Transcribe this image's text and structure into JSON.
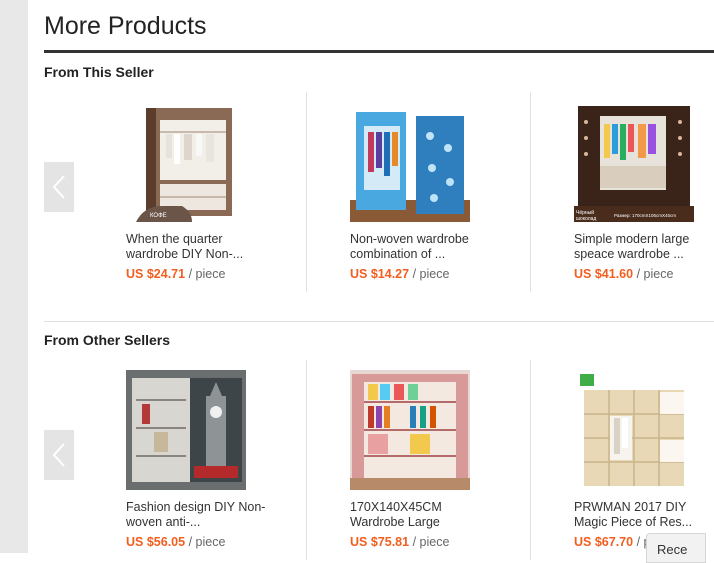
{
  "page": {
    "heading": "More Products"
  },
  "sections": [
    {
      "title": "From This Seller",
      "products": [
        {
          "title_line1": "When the quarter",
          "title_line2": "wardrobe DIY Non-...",
          "price": "US $24.71",
          "unit": "/ piece",
          "image_badge": "КОФЕ",
          "colors": [
            "#8a6a55",
            "#5a3d2b"
          ]
        },
        {
          "title_line1": "Non-woven wardrobe",
          "title_line2": "combination of ...",
          "price": "US $14.27",
          "unit": "/ piece",
          "colors": [
            "#4aa8e0",
            "#2f7fbf"
          ]
        },
        {
          "title_line1": "Simple modern large",
          "title_line2": "speace wardrobe ...",
          "price": "US $41.60",
          "unit": "/ piece",
          "image_caption_left": "Чёрный шоколад",
          "image_caption_right": "Размер: 170cmX105cmX45cm",
          "colors": [
            "#3a2318",
            "#1e120b"
          ]
        }
      ]
    },
    {
      "title": "From Other Sellers",
      "products": [
        {
          "title_line1": "Fashion design DIY Non-",
          "title_line2": "woven anti-...",
          "price": "US $56.05",
          "unit": "/ piece",
          "colors": [
            "#5d6a6e",
            "#3d4548"
          ]
        },
        {
          "title_line1": "170X140X45CM",
          "title_line2": "Wardrobe Large",
          "price": "US $75.81",
          "unit": "/ piece",
          "colors": [
            "#d89a98",
            "#b56b6a"
          ]
        },
        {
          "title_line1": "PRWMAN 2017 DIY",
          "title_line2": "Magic Piece of Res...",
          "price": "US $67.70",
          "unit": "/ piece",
          "colors": [
            "#e9d8b5",
            "#c9b48c"
          ]
        }
      ]
    }
  ],
  "recent_tab": {
    "label": "Rece"
  },
  "icons": {
    "carousel_prev": "chevron-left-icon"
  }
}
